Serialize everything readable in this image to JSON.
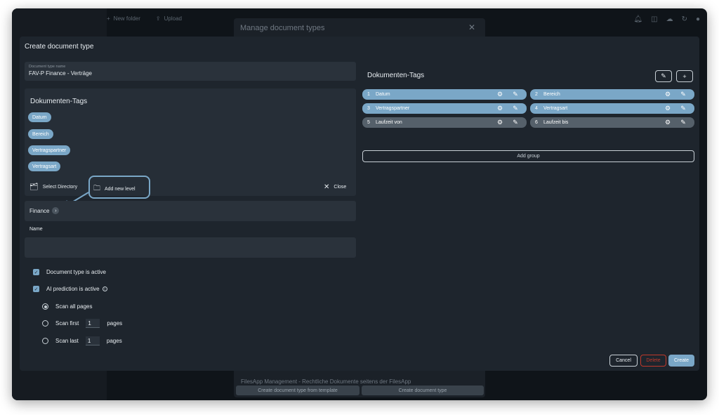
{
  "background": {
    "toolbar": {
      "new_folder": "New folder",
      "upload": "Upload"
    },
    "modal_title": "Manage document types",
    "modal_item": "FilesApp Management - Rechtliche Dokumente seitens der FilesApp",
    "btn_from_template": "Create document type from template",
    "btn_create_type": "Create document type"
  },
  "dialog": {
    "title": "Create document type",
    "name_field": {
      "label": "Document type name",
      "value": "FAV-P Finance - Verträge"
    },
    "tags_section": {
      "title": "Dokumenten-Tags",
      "chips": [
        "Datum",
        "Bereich",
        "Vertragspartner",
        "Vertragsart"
      ]
    },
    "actions": {
      "select_directory": "Select Directory",
      "add_new_level": "Add new level",
      "close": "Close"
    },
    "path": {
      "crumb": "Finance"
    },
    "name_label": "Name",
    "name_input": {
      "value": "",
      "placeholder": ""
    },
    "options": {
      "active": "Document type is active",
      "ai_prediction": "AI prediction is active",
      "scan_all": "Scan all pages",
      "scan_first": "Scan first",
      "scan_last": "Scan last",
      "pages": "pages",
      "first_count": "1",
      "last_count": "1"
    },
    "right": {
      "title": "Dokumenten-Tags",
      "tags": [
        {
          "num": "1",
          "name": "Datum",
          "style": "blue"
        },
        {
          "num": "2",
          "name": "Bereich",
          "style": "blue"
        },
        {
          "num": "3",
          "name": "Vertragspartner",
          "style": "blue"
        },
        {
          "num": "4",
          "name": "Vertragsart",
          "style": "blue"
        },
        {
          "num": "5",
          "name": "Laufzeit von",
          "style": "gray"
        },
        {
          "num": "6",
          "name": "Laufzeit bis",
          "style": "gray"
        }
      ],
      "add_group": "Add group"
    },
    "footer": {
      "cancel": "Cancel",
      "delete": "Delete",
      "create": "Create"
    }
  },
  "colors": {
    "accent": "#7aa7c7",
    "danger": "#c0392b",
    "dialog_bg": "#1e252d"
  }
}
